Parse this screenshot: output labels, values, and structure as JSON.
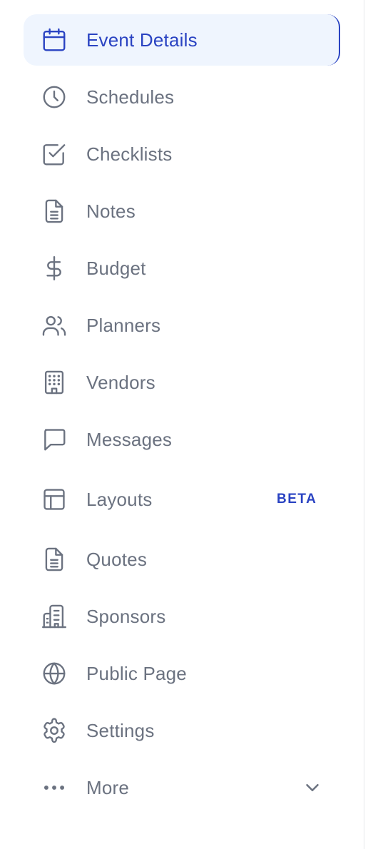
{
  "sidebar": {
    "active_color": "#2a43c2",
    "active_background": "#eff5fe",
    "items": [
      {
        "label": "Event Details",
        "icon": "calendar-icon",
        "active": true
      },
      {
        "label": "Schedules",
        "icon": "clock-icon"
      },
      {
        "label": "Checklists",
        "icon": "checkbox-icon"
      },
      {
        "label": "Notes",
        "icon": "document-icon"
      },
      {
        "label": "Budget",
        "icon": "dollar-icon"
      },
      {
        "label": "Planners",
        "icon": "users-icon"
      },
      {
        "label": "Vendors",
        "icon": "building-icon"
      },
      {
        "label": "Messages",
        "icon": "chat-icon"
      },
      {
        "label": "Layouts",
        "icon": "layout-icon",
        "badge": "BETA"
      },
      {
        "label": "Quotes",
        "icon": "document-icon"
      },
      {
        "label": "Sponsors",
        "icon": "office-building-icon"
      },
      {
        "label": "Public Page",
        "icon": "globe-icon"
      },
      {
        "label": "Settings",
        "icon": "gear-icon"
      },
      {
        "label": "More",
        "icon": "ellipsis-icon",
        "expandable": true
      }
    ]
  }
}
